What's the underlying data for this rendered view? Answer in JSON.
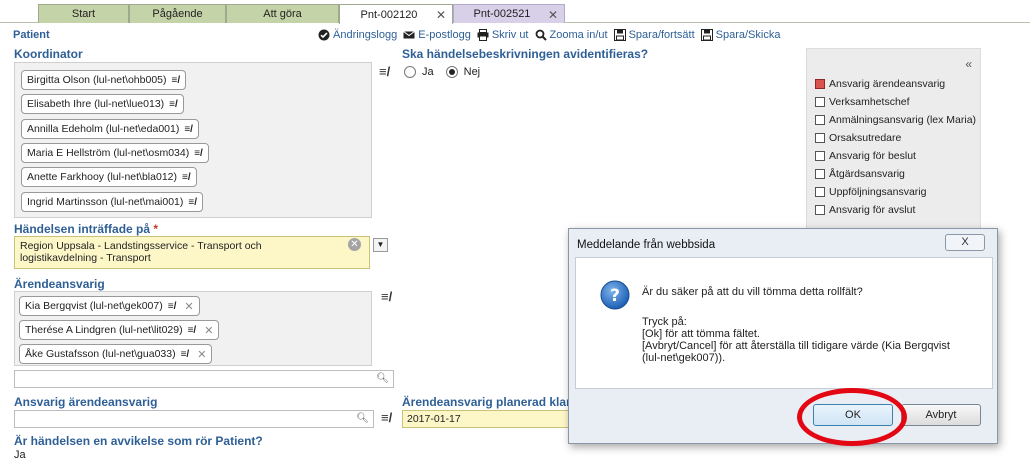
{
  "tabs": [
    {
      "label": "Start"
    },
    {
      "label": "Pågående"
    },
    {
      "label": "Att göra"
    },
    {
      "label": "Pnt-002120"
    },
    {
      "label": "Pnt-002521"
    }
  ],
  "page": {
    "section_label": "Patient",
    "toolbar": [
      {
        "label": "Ändringslogg",
        "icon": "check-circle-icon"
      },
      {
        "label": "E-postlogg",
        "icon": "envelope-icon"
      },
      {
        "label": "Skriv ut",
        "icon": "printer-icon"
      },
      {
        "label": "Zooma in/ut",
        "icon": "magnifier-icon"
      },
      {
        "label": "Spara/fortsätt",
        "icon": "floppy-icon"
      },
      {
        "label": "Spara/Skicka",
        "icon": "floppy-icon"
      }
    ]
  },
  "coordinator": {
    "title": "Koordinator",
    "people": [
      "Birgitta Olson (lul-net\\ohb005)",
      "Elisabeth Ihre (lul-net\\lue013)",
      "Annilla Edeholm (lul-net\\eda001)",
      "Maria E Hellström (lul-net\\osm034)",
      "Anette Farkhooy (lul-net\\bla012)",
      "Ingrid Martinsson (lul-net\\mai001)"
    ]
  },
  "anonymize": {
    "question": "Ska händelsebeskrivningen avidentifieras?",
    "yes": "Ja",
    "no": "Nej",
    "selected": "Nej"
  },
  "incident_location": {
    "label": "Händelsen inträffade på",
    "required_mark": "*",
    "line1": "Region Uppsala -  Landstingsservice -  Transport och",
    "line2": "logistikavdelning -  Transport"
  },
  "case_responsible": {
    "title": "Ärendeansvarig",
    "people": [
      "Kia Bergqvist (lul-net\\gek007)",
      "Therése A Lindgren (lul-net\\lit029)",
      "Åke Gustafsson (lul-net\\gua033)"
    ]
  },
  "responsible_case_owner": {
    "title": "Ansvarig ärendeansvarig"
  },
  "planned_ready": {
    "title": "Ärendeansvarig planerad klar",
    "value": "2017-01-17"
  },
  "deviation": {
    "question": "Är händelsen en avvikelse som rör Patient?",
    "answer": "Ja"
  },
  "role_panel": {
    "collapse": "«",
    "items": [
      {
        "label": "Ansvarig ärendeansvarig",
        "highlight": true
      },
      {
        "label": "Verksamhetschef"
      },
      {
        "label": "Anmälningsansvarig (lex Maria)"
      },
      {
        "label": "Orsaksutredare"
      },
      {
        "label": "Ansvarig för beslut"
      },
      {
        "label": "Åtgärdsansvarig"
      },
      {
        "label": "Uppföljningsansvarig"
      },
      {
        "label": "Ansvarig för avslut"
      }
    ]
  },
  "dialog": {
    "title": "Meddelande från webbsida",
    "question": "Är du säker på att du vill tömma detta rollfält?",
    "line1": "Tryck på:",
    "line2": "[Ok] för att tömma fältet.",
    "line3": "[Avbryt/Cancel] för att återställa till tidigare värde (Kia Bergqvist",
    "line4": "(lul-net\\gek007)).",
    "ok": "OK",
    "cancel": "Avbryt",
    "close": "X"
  },
  "colors": {
    "tab_green": "#c5d3a8",
    "accent_blue": "#2e5f96",
    "highlight_red": "#e30613",
    "yellow_field": "#fdf7c8"
  }
}
